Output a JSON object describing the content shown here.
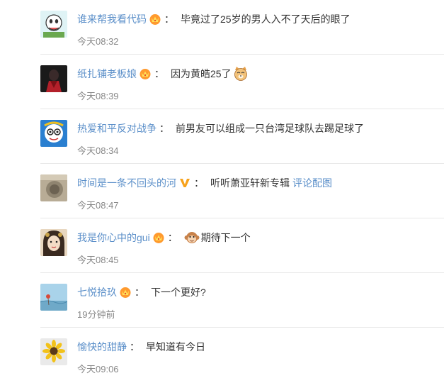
{
  "comments": [
    {
      "user": "谁来帮我看代码",
      "badge": "crown-badge",
      "text": "毕竟过了25岁的男人入不了天后的眼了",
      "time": "今天08:32"
    },
    {
      "user": "纸扎铺老板娘",
      "badge": "crown-badge",
      "text": "因为黄皓25了",
      "emoji": "cat-face-emoji",
      "time": "今天08:39"
    },
    {
      "user": "热爱和平反对战争",
      "text": "前男友可以组成一只台湾足球队去踢足球了",
      "time": "今天08:34"
    },
    {
      "user": "时间是一条不回头的河",
      "badge": "verified-v-badge",
      "text": "听听萧亚轩新专辑",
      "link": "评论配图",
      "time": "今天08:47"
    },
    {
      "user": "我是你心中的gui",
      "badge": "crown-badge",
      "lead_emoji": "monkey-emoji",
      "text": "期待下一个",
      "time": "今天08:45"
    },
    {
      "user": "七悦拾玖",
      "badge": "crown-badge",
      "text": "下一个更好?",
      "time": "19分钟前"
    },
    {
      "user": "愉快的甜静",
      "text": "早知道有今日",
      "time": "今天09:06"
    }
  ],
  "colon": "："
}
